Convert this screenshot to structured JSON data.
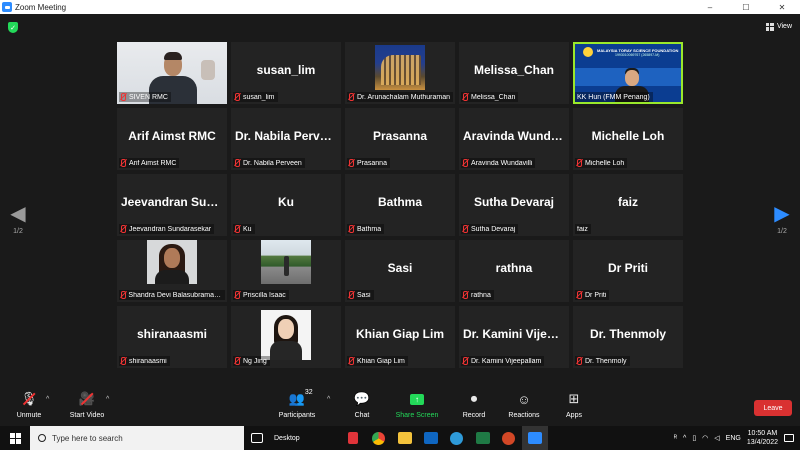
{
  "window": {
    "title": "Zoom Meeting",
    "controls": [
      "–",
      "☐",
      "✕"
    ]
  },
  "header": {
    "view_label": "View"
  },
  "nav": {
    "page_indicator": "1/2"
  },
  "tiles": [
    {
      "big": "",
      "label": "SIVEN RMC",
      "photo": "siven"
    },
    {
      "big": "susan_lim",
      "label": "susan_lim",
      "photo": ""
    },
    {
      "big": "",
      "label": "Dr. Arunachalam Muthuraman",
      "photo": "arun"
    },
    {
      "big": "Melissa_Chan",
      "label": "Melissa_Chan",
      "photo": ""
    },
    {
      "big": "",
      "label": "KK Hun (FMM Penang)",
      "photo": "kk",
      "active": true,
      "nomic": true
    },
    {
      "big": "Arif Aimst RMC",
      "label": "Arif Aimst RMC",
      "photo": ""
    },
    {
      "big": "Dr. Nabila Perveen",
      "label": "Dr. Nabila Perveen",
      "photo": ""
    },
    {
      "big": "Prasanna",
      "label": "Prasanna",
      "photo": ""
    },
    {
      "big": "Aravinda Wundavilli",
      "label": "Aravinda Wundavilli",
      "photo": ""
    },
    {
      "big": "Michelle Loh",
      "label": "Michelle Loh",
      "photo": ""
    },
    {
      "big": "Jeevandran Sundarasekar",
      "label": "Jeevandran Sundarasekar",
      "photo": ""
    },
    {
      "big": "Ku",
      "label": "Ku",
      "photo": ""
    },
    {
      "big": "Bathma",
      "label": "Bathma",
      "photo": ""
    },
    {
      "big": "Sutha Devaraj",
      "label": "Sutha Devaraj",
      "photo": ""
    },
    {
      "big": "faiz",
      "label": "faiz",
      "photo": "",
      "nomic": true
    },
    {
      "big": "",
      "label": "Shandra Devi Balasubramaniam",
      "photo": "shandra"
    },
    {
      "big": "",
      "label": "Priscilla Isaac",
      "photo": "priscilla"
    },
    {
      "big": "Sasi",
      "label": "Sasi",
      "photo": ""
    },
    {
      "big": "rathna",
      "label": "rathna",
      "photo": ""
    },
    {
      "big": "Dr Priti",
      "label": "Dr Priti",
      "photo": ""
    },
    {
      "big": "shiranaasmi",
      "label": "shiranaasmi",
      "photo": ""
    },
    {
      "big": "",
      "label": "Ng Jing",
      "photo": "ng"
    },
    {
      "big": "Khian Giap Lim",
      "label": "Khian Giap Lim",
      "photo": ""
    },
    {
      "big": "Dr. Kamini Vijeepallam",
      "label": "Dr. Kamini Vijeepallam",
      "photo": ""
    },
    {
      "big": "Dr. Thenmoly",
      "label": "Dr. Thenmoly",
      "photo": ""
    }
  ],
  "kk_slide": {
    "org": "MALAYSIA TORAY SCIENCE FOUNDATION",
    "reg": "1993010069767 (265897-M)",
    "site": "www.mtsf.org"
  },
  "toolbar": {
    "unmute": "Unmute",
    "start_video": "Start Video",
    "participants": "Participants",
    "participants_count": "32",
    "chat": "Chat",
    "share_screen": "Share Screen",
    "record": "Record",
    "reactions": "Reactions",
    "apps": "Apps",
    "leave": "Leave"
  },
  "taskbar": {
    "search_placeholder": "Type here to search",
    "desktop_label": "Desktop",
    "language": "ENG",
    "time": "10:50 AM",
    "date": "13/4/2022"
  },
  "colors": {
    "accent_blue": "#2d8cff",
    "active_border": "#9ae82b",
    "share_green": "#23d959",
    "leave_red": "#d93131"
  }
}
